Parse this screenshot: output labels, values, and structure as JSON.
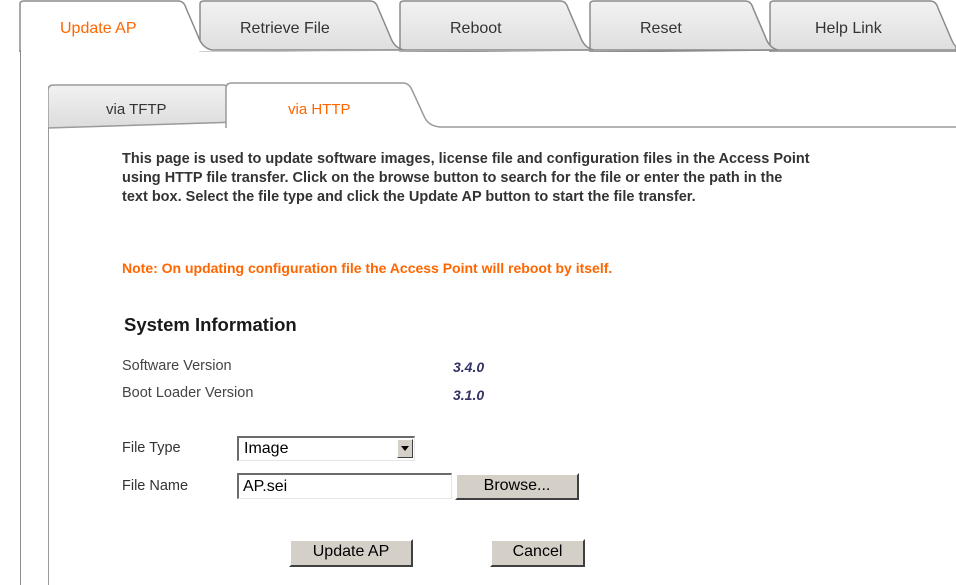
{
  "top_tabs": [
    {
      "label": "Update AP",
      "active": true
    },
    {
      "label": "Retrieve File",
      "active": false
    },
    {
      "label": "Reboot",
      "active": false
    },
    {
      "label": "Reset",
      "active": false
    },
    {
      "label": "Help Link",
      "active": false
    }
  ],
  "sub_tabs": [
    {
      "label": "via TFTP",
      "active": false
    },
    {
      "label": "via HTTP",
      "active": true
    }
  ],
  "description": "This page is used to update software images, license file and configuration files in the Access Point using HTTP file transfer. Click on the browse button to search for the file or enter the path in the text box. Select the file type and click the Update AP button to start the file transfer.",
  "note": "Note: On updating configuration file the Access Point will reboot by itself.",
  "system_info": {
    "title": "System Information",
    "rows": [
      {
        "label": "Software Version",
        "value": "3.4.0"
      },
      {
        "label": "Boot Loader Version",
        "value": "3.1.0"
      }
    ]
  },
  "form": {
    "file_type_label": "File Type",
    "file_type_value": "Image",
    "file_name_label": "File Name",
    "file_name_value": "AP.sei",
    "browse_label": "Browse...",
    "update_label": "Update AP",
    "cancel_label": "Cancel"
  },
  "colors": {
    "accent": "#ff6600",
    "tab_inactive_fill": "#e8e8e8",
    "tab_border": "#8b8b8b",
    "button_face": "#d4d0c8"
  }
}
